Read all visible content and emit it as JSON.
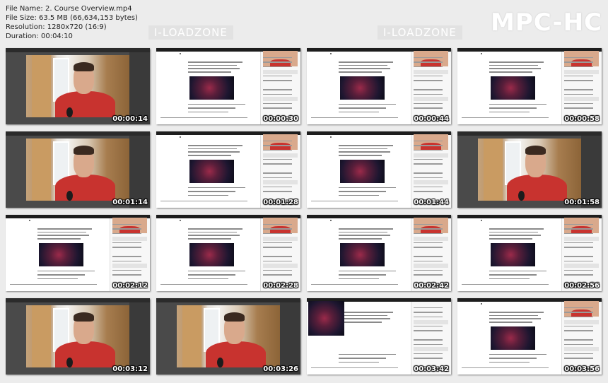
{
  "header": {
    "file_name": "File Name: 2. Course Overview.mp4",
    "file_size": "File Size: 63.5 MB (66,634,153 bytes)",
    "resolution": "Resolution: 1280x720 (16:9)",
    "duration": "Duration: 00:04:10"
  },
  "brand": "MPC-HC",
  "watermarks": [
    "I-LOADZONE",
    "I-LOADZONE"
  ],
  "thumbnails": [
    {
      "time": "00:00:14",
      "kind": "webcam"
    },
    {
      "time": "00:00:30",
      "kind": "lecture"
    },
    {
      "time": "00:00:44",
      "kind": "lecture"
    },
    {
      "time": "00:00:58",
      "kind": "lecture"
    },
    {
      "time": "00:01:14",
      "kind": "webcam"
    },
    {
      "time": "00:01:28",
      "kind": "lecture"
    },
    {
      "time": "00:01:44",
      "kind": "lecture"
    },
    {
      "time": "00:01:58",
      "kind": "webcam"
    },
    {
      "time": "00:02:12",
      "kind": "lecture"
    },
    {
      "time": "00:02:28",
      "kind": "lecture"
    },
    {
      "time": "00:02:42",
      "kind": "lecture"
    },
    {
      "time": "00:02:56",
      "kind": "lecture"
    },
    {
      "time": "00:03:12",
      "kind": "webcam"
    },
    {
      "time": "00:03:26",
      "kind": "webcam"
    },
    {
      "time": "00:03:42",
      "kind": "lecture-alt"
    },
    {
      "time": "00:03:56",
      "kind": "lecture"
    }
  ]
}
